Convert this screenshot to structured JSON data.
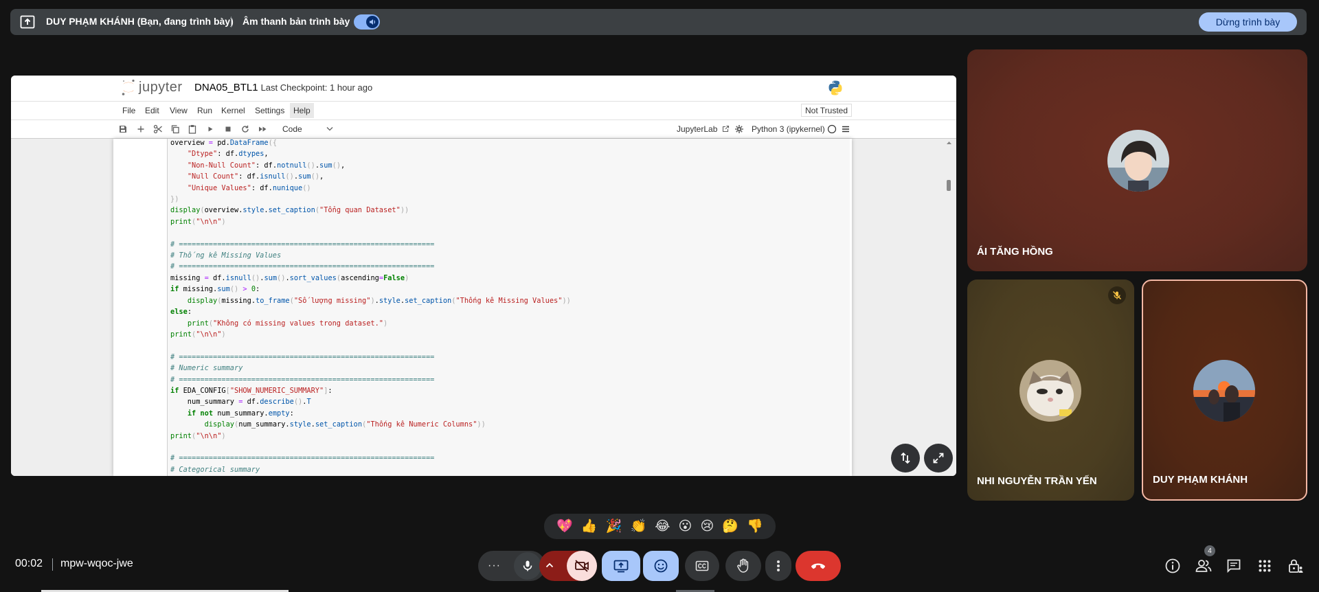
{
  "banner": {
    "presenter_text": "DUY PHẠM KHÁNH (Bạn, đang trình bày)",
    "audio_label": "Âm thanh bản trình bày",
    "audio_enabled": true,
    "stop_button": "Dừng trình bày"
  },
  "jupyter": {
    "wordmark": "jupyter",
    "notebook_name": "DNA05_BTL1",
    "checkpoint": "Last Checkpoint: 1 hour ago",
    "menu": [
      "File",
      "Edit",
      "View",
      "Run",
      "Kernel",
      "Settings",
      "Help"
    ],
    "trust": "Not Trusted",
    "cell_type": "Code",
    "jupyterlab_link": "JupyterLab",
    "kernel": "Python 3 (ipykernel)"
  },
  "code_lines": [
    "overview = pd.DataFrame({",
    "    \"Dtype\": df.dtypes,",
    "    \"Non-Null Count\": df.notnull().sum(),",
    "    \"Null Count\": df.isnull().sum(),",
    "    \"Unique Values\": df.nunique()",
    "})",
    "display(overview.style.set_caption(\"Tổng quan Dataset\"))",
    "print(\"\\n\\n\")",
    "",
    "# ============================================================",
    "# Thống kê Missing Values",
    "# ============================================================",
    "missing = df.isnull().sum().sort_values(ascending=False)",
    "if missing.sum() > 0:",
    "    display(missing.to_frame(\"Số lượng missing\").style.set_caption(\"Thống kê Missing Values\"))",
    "else:",
    "    print(\"Không có missing values trong dataset.\")",
    "print(\"\\n\\n\")",
    "",
    "# ============================================================",
    "# Numeric summary",
    "# ============================================================",
    "if EDA_CONFIG[\"SHOW_NUMERIC_SUMMARY\"]:",
    "    num_summary = df.describe().T",
    "    if not num_summary.empty:",
    "        display(num_summary.style.set_caption(\"Thống kê Numeric Columns\"))",
    "print(\"\\n\\n\")",
    "",
    "# ============================================================",
    "# Categorical summary"
  ],
  "participants": [
    {
      "name": "ÁI TĂNG HỒNG",
      "bg": "#6b2e21",
      "muted": false,
      "speaking": false
    },
    {
      "name": "NHI NGUYỄN TRẦN YẾN",
      "bg": "#534423",
      "muted": true,
      "speaking": false
    },
    {
      "name": "DUY PHẠM KHÁNH",
      "bg": "#5a2a14",
      "muted": false,
      "speaking": true
    }
  ],
  "reactions": [
    "💖",
    "👍",
    "🎉",
    "👏",
    "😂",
    "😮",
    "😢",
    "🤔",
    "👎"
  ],
  "meeting": {
    "time": "00:02",
    "code": "mpw-wqoc-jwe",
    "people_count": "4"
  },
  "controls": {
    "more_options": "···",
    "mic": "mic-icon",
    "camera": "camera-off-icon",
    "present": "present-icon",
    "emoji": "emoji-icon",
    "captions": "captions-icon",
    "raise_hand": "hand-icon",
    "leave": "end-call-icon"
  },
  "colors": {
    "accent": "#a8c7fa",
    "end_call": "#dc362e",
    "camera_off_bg": "#f9dedc",
    "active_blue": "#a8c7fa"
  }
}
